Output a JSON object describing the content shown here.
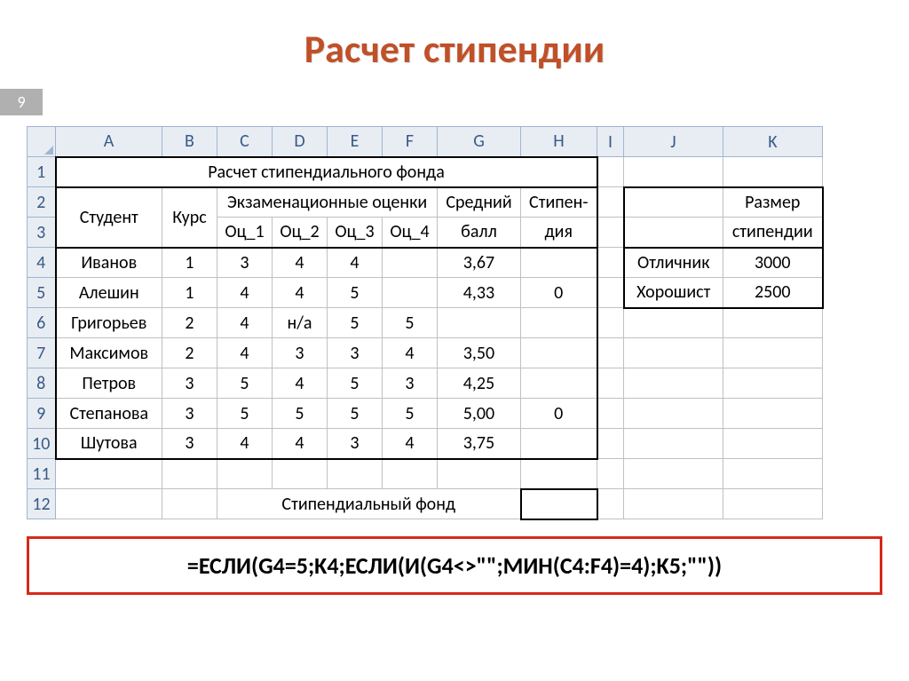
{
  "title": "Расчет стипендии",
  "page_num": "9",
  "cols": [
    "A",
    "B",
    "C",
    "D",
    "E",
    "F",
    "G",
    "H",
    "I",
    "J",
    "K"
  ],
  "rows": [
    "1",
    "2",
    "3",
    "4",
    "5",
    "6",
    "7",
    "8",
    "9",
    "10",
    "11",
    "12"
  ],
  "cells": {
    "r1_title": "Расчет стипендиального фонда",
    "student": "Студент",
    "course": "Курс",
    "exam_header": "Экзаменационные оценки",
    "oc1": "Оц_1",
    "oc2": "Оц_2",
    "oc3": "Оц_3",
    "oc4": "Оц_4",
    "avg": "Средний балл",
    "avg_top": "Средний",
    "avg_bot": "балл",
    "stip_top": "Стипен-",
    "stip_bot": "дия",
    "size_top": "Размер",
    "size_bot": "стипендии",
    "excellent": "Отличник",
    "good": "Хорошист",
    "fund_label": "Стипендиальный фонд"
  },
  "data": [
    {
      "name": "Иванов",
      "course": "1",
      "o1": "3",
      "o2": "4",
      "o3": "4",
      "o4": "",
      "avg": "3,67",
      "stip": ""
    },
    {
      "name": "Алешин",
      "course": "1",
      "o1": "4",
      "o2": "4",
      "o3": "5",
      "o4": "",
      "avg": "4,33",
      "stip": "0"
    },
    {
      "name": "Григорьев",
      "course": "2",
      "o1": "4",
      "o2": "н/а",
      "o3": "5",
      "o4": "5",
      "avg": "",
      "stip": ""
    },
    {
      "name": "Максимов",
      "course": "2",
      "o1": "4",
      "o2": "3",
      "o3": "3",
      "o4": "4",
      "avg": "3,50",
      "stip": ""
    },
    {
      "name": "Петров",
      "course": "3",
      "o1": "5",
      "o2": "4",
      "o3": "5",
      "o4": "3",
      "avg": "4,25",
      "stip": ""
    },
    {
      "name": "Степанова",
      "course": "3",
      "o1": "5",
      "o2": "5",
      "o3": "5",
      "o4": "5",
      "avg": "5,00",
      "stip": "0"
    },
    {
      "name": "Шутова",
      "course": "3",
      "o1": "4",
      "o2": "4",
      "o3": "3",
      "o4": "4",
      "avg": "3,75",
      "stip": ""
    }
  ],
  "side": {
    "excellent_val": "3000",
    "good_val": "2500"
  },
  "formula": "=ЕСЛИ(G4=5;K4;ЕСЛИ(И(G4<>\"\";МИН(C4:F4)=4);K5;\"\"))"
}
